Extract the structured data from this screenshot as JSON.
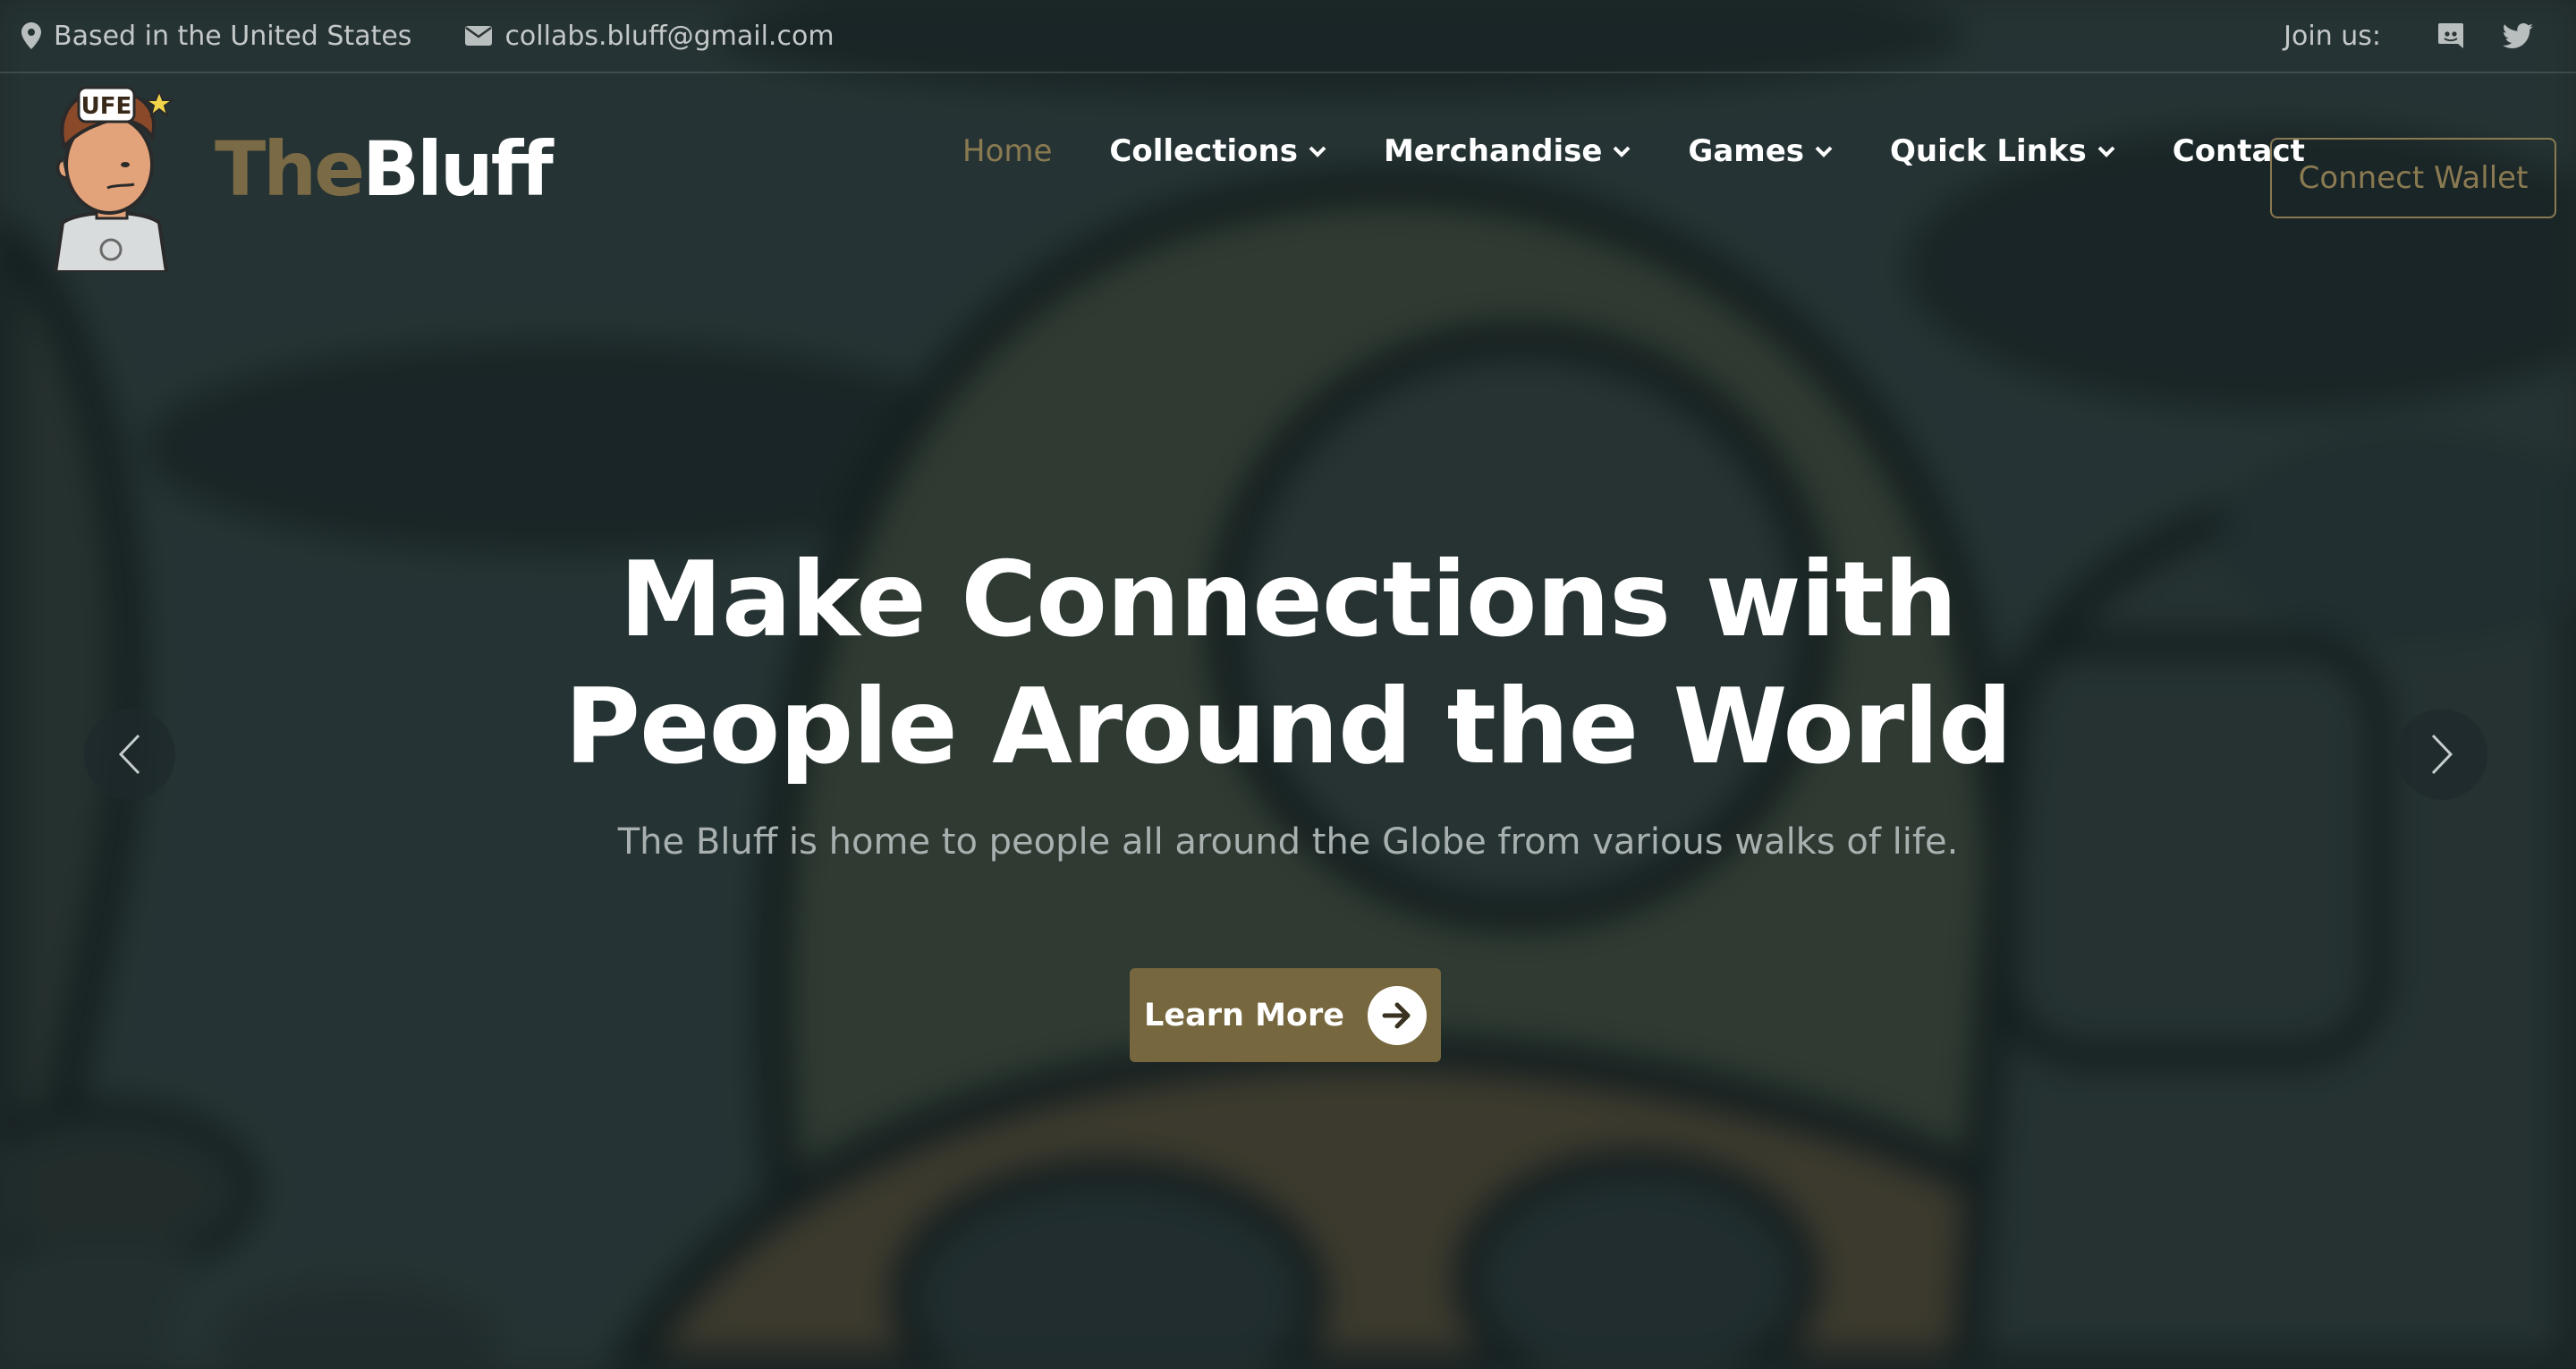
{
  "topbar": {
    "location": "Based in the United States",
    "email": "collabs.bluff@gmail.com",
    "join_label": "Join us:",
    "icons": {
      "location": "map-pin-icon",
      "email": "envelope-icon",
      "discord": "discord-icon",
      "twitter": "twitter-icon"
    }
  },
  "brand": {
    "the": "The",
    "bluff": "Bluff",
    "mascot_badge": "UFE"
  },
  "nav": {
    "items": [
      {
        "label": "Home",
        "active": true,
        "dropdown": false
      },
      {
        "label": "Collections",
        "active": false,
        "dropdown": true
      },
      {
        "label": "Merchandise",
        "active": false,
        "dropdown": true
      },
      {
        "label": "Games",
        "active": false,
        "dropdown": true
      },
      {
        "label": "Quick Links",
        "active": false,
        "dropdown": true
      },
      {
        "label": "Contact",
        "active": false,
        "dropdown": false
      }
    ],
    "wallet_button": "Connect Wallet"
  },
  "hero": {
    "title_line1": "Make Connections with",
    "title_line2": "People Around the World",
    "subtitle": "The Bluff is home to people all around the Globe from various walks of life.",
    "cta": "Learn More"
  },
  "colors": {
    "accent": "#77673f",
    "accent_text": "#8a7a52",
    "background": "#2a3434",
    "text": "#ffffff"
  }
}
